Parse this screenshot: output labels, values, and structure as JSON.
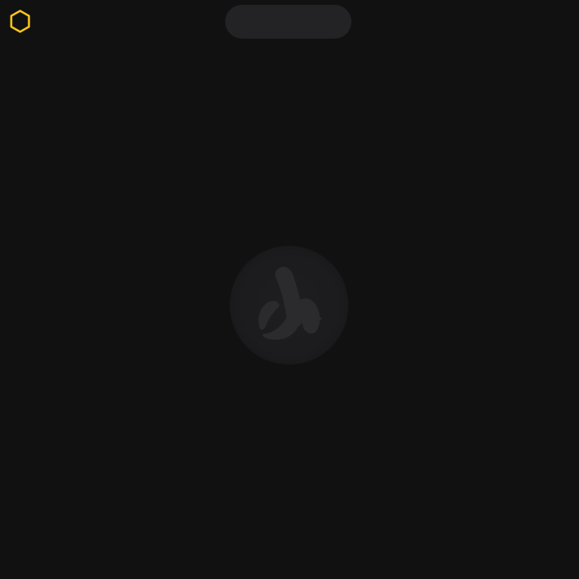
{
  "theme": {
    "background": "#111111",
    "accent": "#f5c518",
    "pill_color": "#232325",
    "badge_color": "#1c1c1e",
    "banana_color": "#2b2b2e"
  },
  "header": {
    "menu_icon": "hexagon-icon",
    "pill_text": ""
  },
  "main": {
    "center_icon": "banana-icon"
  }
}
